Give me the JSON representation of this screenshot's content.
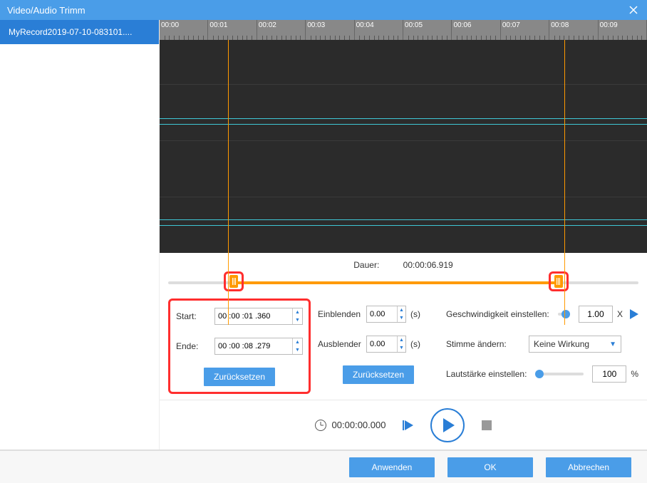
{
  "title": "Video/Audio Trimm",
  "sidebar": {
    "file": "MyRecord2019-07-10-083101...."
  },
  "ruler": [
    "00:00",
    "00:01",
    "00:02",
    "00:03",
    "00:04",
    "00:05",
    "00:06",
    "00:07",
    "00:08",
    "00:09"
  ],
  "duration": {
    "label": "Dauer:",
    "value": "00:00:06.919"
  },
  "markers": {
    "start_pct": 14,
    "end_pct": 83
  },
  "trim": {
    "start_label": "Start:",
    "start_value": "00 :00 :01 .360",
    "end_label": "Ende:",
    "end_value": "00 :00 :08 .279",
    "reset": "Zurücksetzen"
  },
  "fade": {
    "in_label": "Einblenden",
    "in_value": "0.00",
    "out_label": "Ausblender",
    "out_value": "0.00",
    "unit": "(s)",
    "reset": "Zurücksetzen"
  },
  "speed": {
    "label": "Geschwindigkeit einstellen:",
    "value": "1.00",
    "x": "X"
  },
  "voice": {
    "label": "Stimme ändern:",
    "value": "Keine Wirkung"
  },
  "volume": {
    "label": "Lautstärke einstellen:",
    "value": "100",
    "pct": "%"
  },
  "playback": {
    "time": "00:00:00.000"
  },
  "footer": {
    "apply": "Anwenden",
    "ok": "OK",
    "cancel": "Abbrechen"
  }
}
